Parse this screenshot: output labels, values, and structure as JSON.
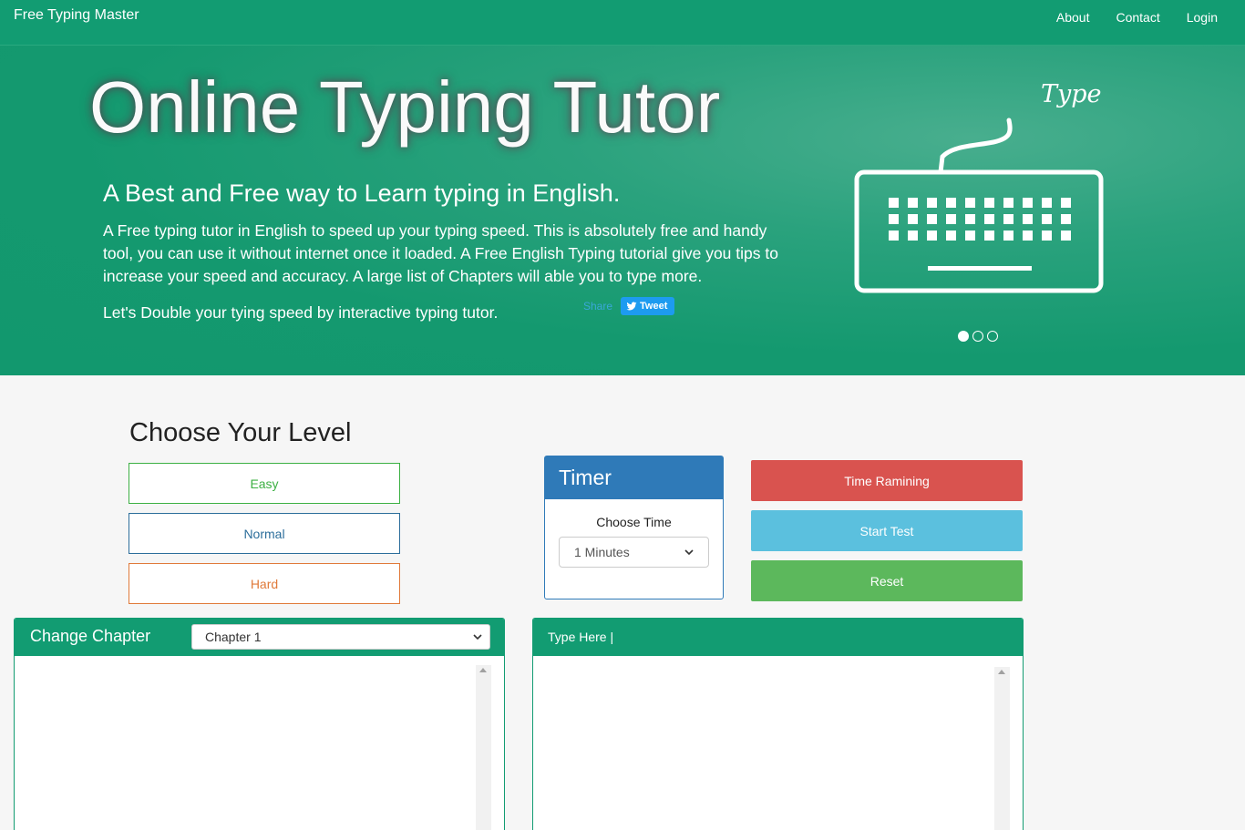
{
  "navbar": {
    "brand": "Free Typing Master",
    "links": [
      "About",
      "Contact",
      "Login"
    ]
  },
  "hero": {
    "title": "Online Typing Tutor",
    "subtitle": "A Best and Free way to Learn typing in English.",
    "description": "A Free typing tutor in English to speed up your typing speed. This is absolutely free and handy tool, you can use it without internet once it loaded. A Free English Typing tutorial give you tips to increase your speed and accuracy. A large list of Chapters will able you to type more.",
    "cta": "Let's Double your tying speed by interactive typing tutor.",
    "share_label": "Share",
    "tweet_label": "Tweet",
    "image_caption": "Type",
    "carousel": {
      "slides": 3,
      "active_index": 0
    }
  },
  "level": {
    "title": "Choose Your Level",
    "options": [
      "Easy",
      "Normal",
      "Hard"
    ]
  },
  "timer": {
    "title": "Timer",
    "label": "Choose Time",
    "selected": "1 Minutes"
  },
  "actions": {
    "time_remaining": "Time Ramining",
    "start": "Start Test",
    "reset": "Reset"
  },
  "chapter_panel": {
    "title": "Change Chapter",
    "selected": "Chapter 1"
  },
  "type_panel": {
    "title": "Type Here |"
  },
  "colors": {
    "primary_green": "#129c72",
    "timer_blue": "#2f7ab8",
    "danger": "#d9534f",
    "info": "#5bc0de",
    "success": "#5cb85c"
  },
  "icons": {
    "keyboard": "keyboard-icon",
    "twitter": "twitter-bird-icon",
    "select_caret": "chevron-down-icon"
  }
}
